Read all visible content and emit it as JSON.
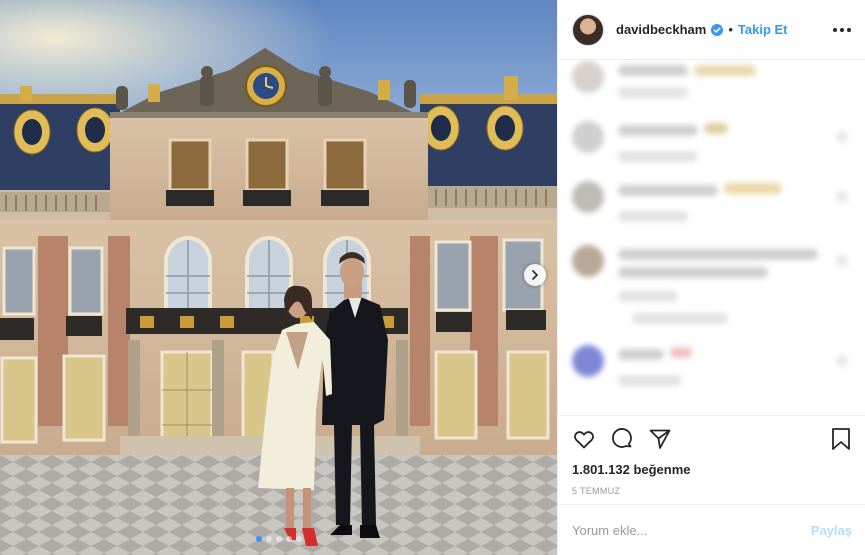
{
  "post": {
    "username": "davidbeckham",
    "verified_icon": "verified-badge-icon",
    "separator": "•",
    "follow_label": "Takip Et",
    "more_icon": "more-options-icon",
    "likes": "1.801.132 beğenme",
    "date": "5 TEMMUZ",
    "comment_placeholder": "Yorum ekle...",
    "post_label": "Paylaş"
  },
  "carousel": {
    "dot_count": 5,
    "active_dot_index": 0,
    "next_icon": "chevron-right-icon"
  },
  "actions": {
    "icons": [
      "heart-icon",
      "comment-icon",
      "share-icon",
      "bookmark-icon"
    ]
  },
  "colors": {
    "accent": "#3897f0",
    "text": "#262626",
    "muted": "#999999",
    "post_button_disabled": "#b2dffc",
    "border": "#efefef"
  }
}
